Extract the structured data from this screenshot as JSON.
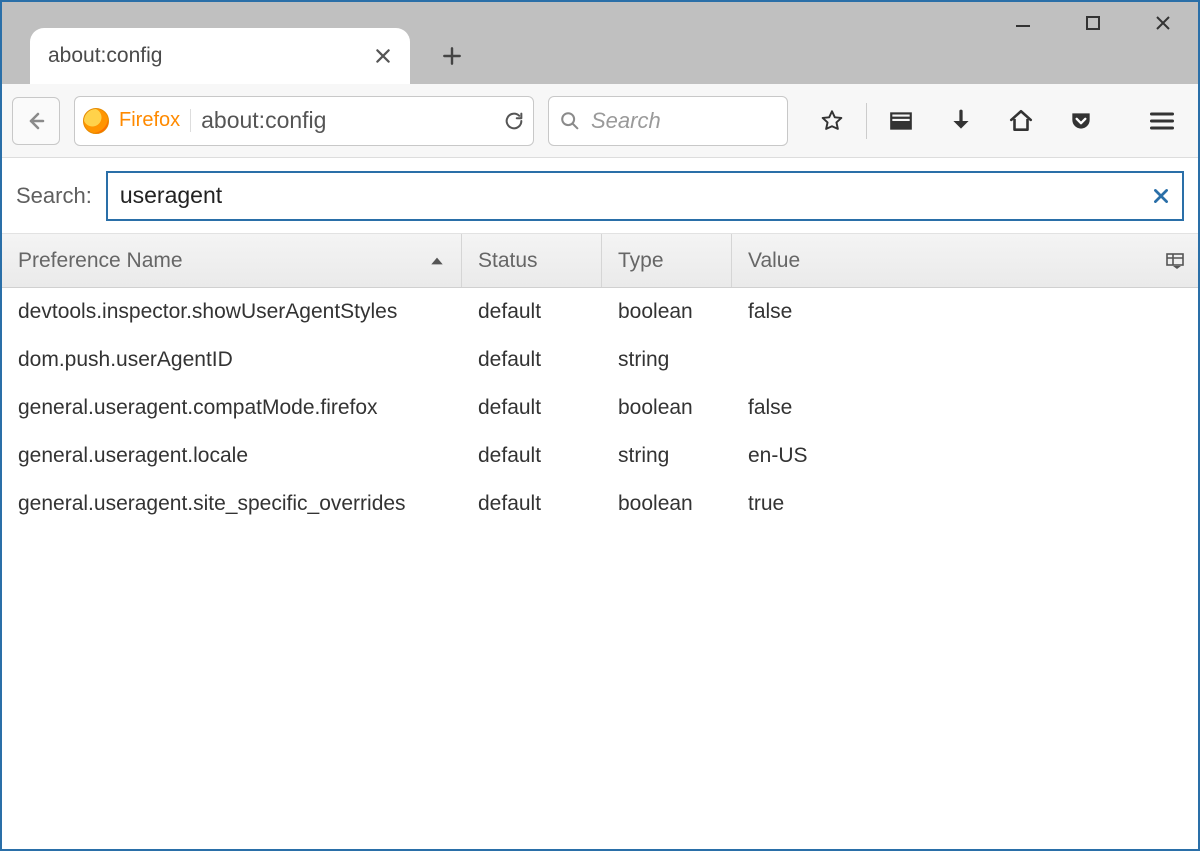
{
  "window": {
    "tab_title": "about:config"
  },
  "toolbar": {
    "identity_label": "Firefox",
    "url": "about:config",
    "search_placeholder": "Search"
  },
  "config": {
    "search_label": "Search:",
    "search_value": "useragent",
    "columns": {
      "name": "Preference Name",
      "status": "Status",
      "type": "Type",
      "value": "Value"
    },
    "sort": {
      "column": "name",
      "direction": "asc"
    },
    "rows": [
      {
        "name": "devtools.inspector.showUserAgentStyles",
        "status": "default",
        "type": "boolean",
        "value": "false"
      },
      {
        "name": "dom.push.userAgentID",
        "status": "default",
        "type": "string",
        "value": ""
      },
      {
        "name": "general.useragent.compatMode.firefox",
        "status": "default",
        "type": "boolean",
        "value": "false"
      },
      {
        "name": "general.useragent.locale",
        "status": "default",
        "type": "string",
        "value": "en-US"
      },
      {
        "name": "general.useragent.site_specific_overrides",
        "status": "default",
        "type": "boolean",
        "value": "true"
      }
    ]
  }
}
